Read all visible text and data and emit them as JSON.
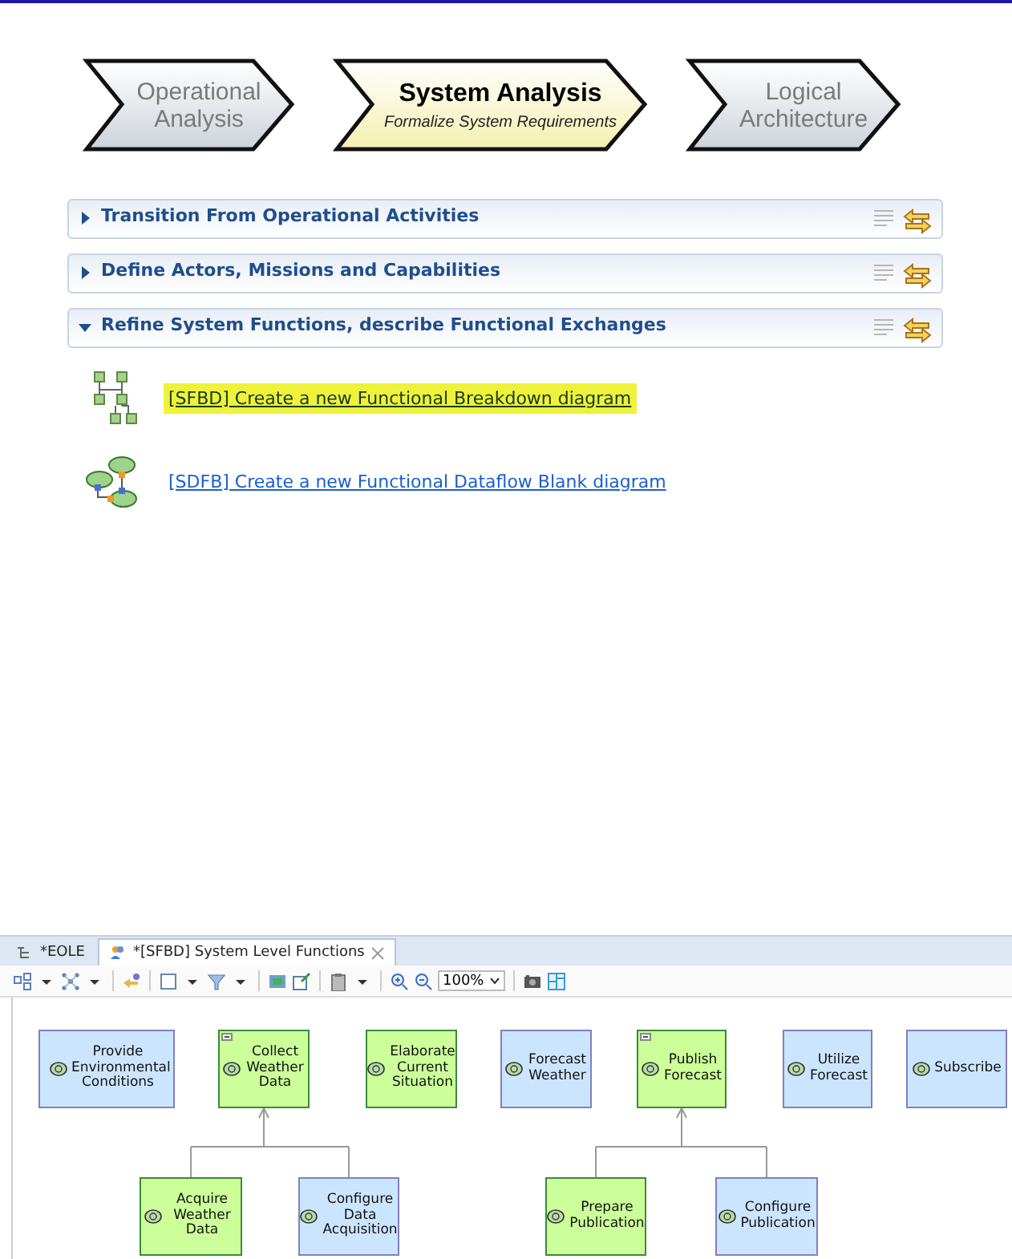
{
  "phases": [
    {
      "title": "Operational Analysis",
      "selected": false
    },
    {
      "title": "System Analysis",
      "subtitle": "Formalize System Requirements",
      "selected": true
    },
    {
      "title": "Logical Architecture",
      "selected": false
    }
  ],
  "sections": [
    {
      "title": "Transition From Operational Activities",
      "expanded": false
    },
    {
      "title": "Define Actors, Missions and Capabilities",
      "expanded": false
    },
    {
      "title": "Refine System Functions, describe Functional Exchanges",
      "expanded": true,
      "links": [
        {
          "kind": "breakdown",
          "text": "[SFBD] Create a new Functional Breakdown diagram",
          "highlighted": true
        },
        {
          "kind": "dataflow",
          "text": "[SDFB] Create a new Functional Dataflow Blank diagram",
          "highlighted": false
        }
      ]
    }
  ],
  "editor": {
    "tabs": [
      {
        "label": "*EOLE",
        "selected": false
      },
      {
        "label": "*[SFBD] System Level Functions",
        "selected": true,
        "closable": true
      }
    ],
    "toolbar": {
      "zoom": "100%"
    },
    "diagram": {
      "functions": [
        {
          "label": "Provide Environmental Conditions",
          "color": "#cce5ff",
          "collapsible": false
        },
        {
          "label": "Collect Weather Data",
          "color": "#ccff99",
          "collapsible": true,
          "children": [
            {
              "label": "Acquire Weather Data",
              "color": "#ccff99",
              "collapsible": false
            },
            {
              "label": "Configure Data Acquisition",
              "color": "#cce5ff",
              "collapsible": false
            }
          ]
        },
        {
          "label": "Elaborate Current Situation",
          "color": "#ccff99",
          "collapsible": false
        },
        {
          "label": "Forecast Weather",
          "color": "#cce5ff",
          "collapsible": false
        },
        {
          "label": "Publish Forecast",
          "color": "#ccff99",
          "collapsible": true,
          "children": [
            {
              "label": "Prepare Publication",
              "color": "#ccff99",
              "collapsible": false
            },
            {
              "label": "Configure Publication",
              "color": "#cce5ff",
              "collapsible": false
            }
          ]
        },
        {
          "label": "Utilize Forecast",
          "color": "#cce5ff",
          "collapsible": false
        },
        {
          "label": "Subscribe",
          "color": "#cce5ff",
          "collapsible": false
        }
      ]
    }
  }
}
